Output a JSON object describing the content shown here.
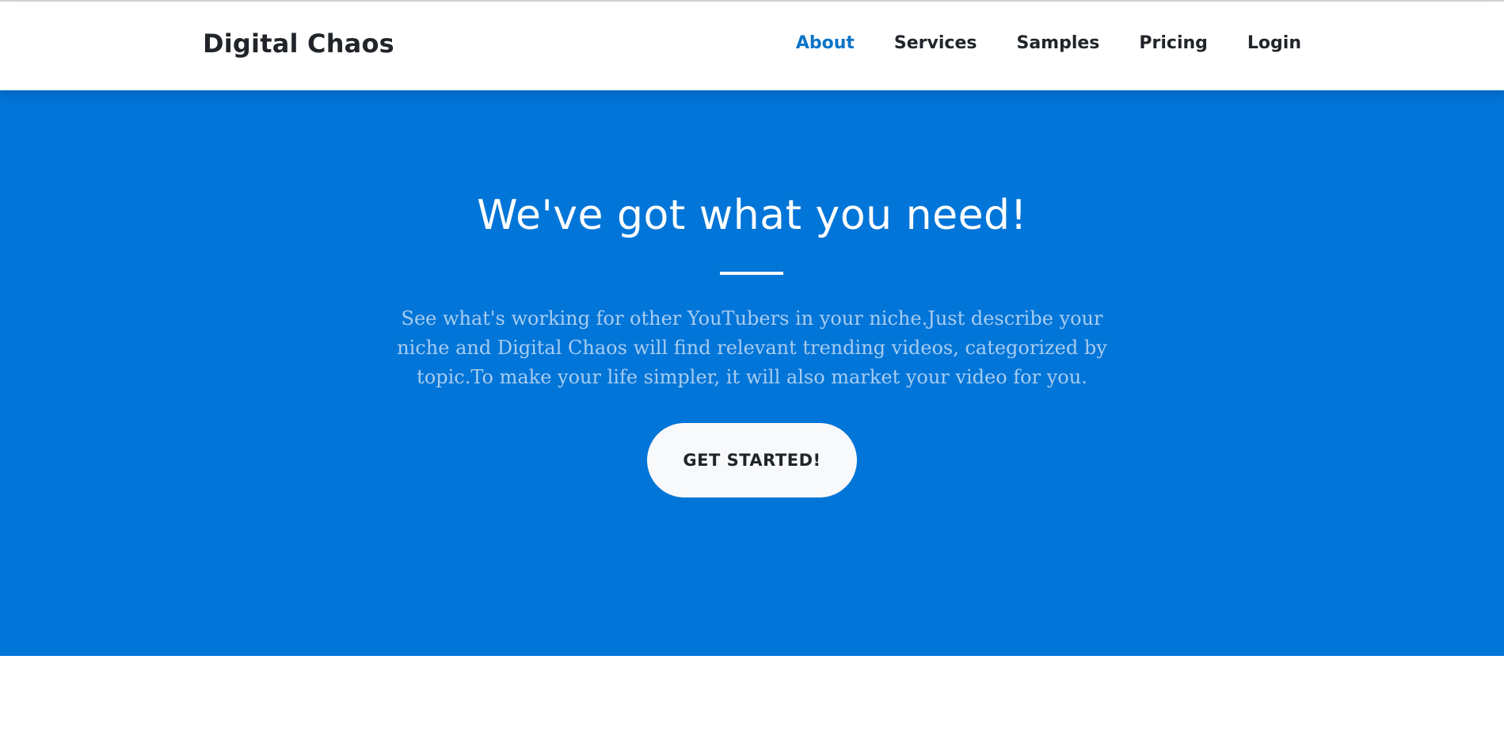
{
  "navbar": {
    "brand": "Digital Chaos",
    "links": [
      {
        "label": "About",
        "active": true
      },
      {
        "label": "Services",
        "active": false
      },
      {
        "label": "Samples",
        "active": false
      },
      {
        "label": "Pricing",
        "active": false
      },
      {
        "label": "Login",
        "active": false
      }
    ]
  },
  "hero": {
    "title": "We've got what you need!",
    "text": "See what's working for other YouTubers in your niche.Just describe your niche and Digital Chaos will find relevant trending videos, categorized by topic.To make your life simpler, it will also market your video for you.",
    "cta_label": "GET STARTED!"
  },
  "colors": {
    "primary": "#0275d8",
    "active_link": "#0b74c8",
    "hero_text": "#a9cdef",
    "button_bg": "#f8f9fa",
    "dark_text": "#212529"
  }
}
